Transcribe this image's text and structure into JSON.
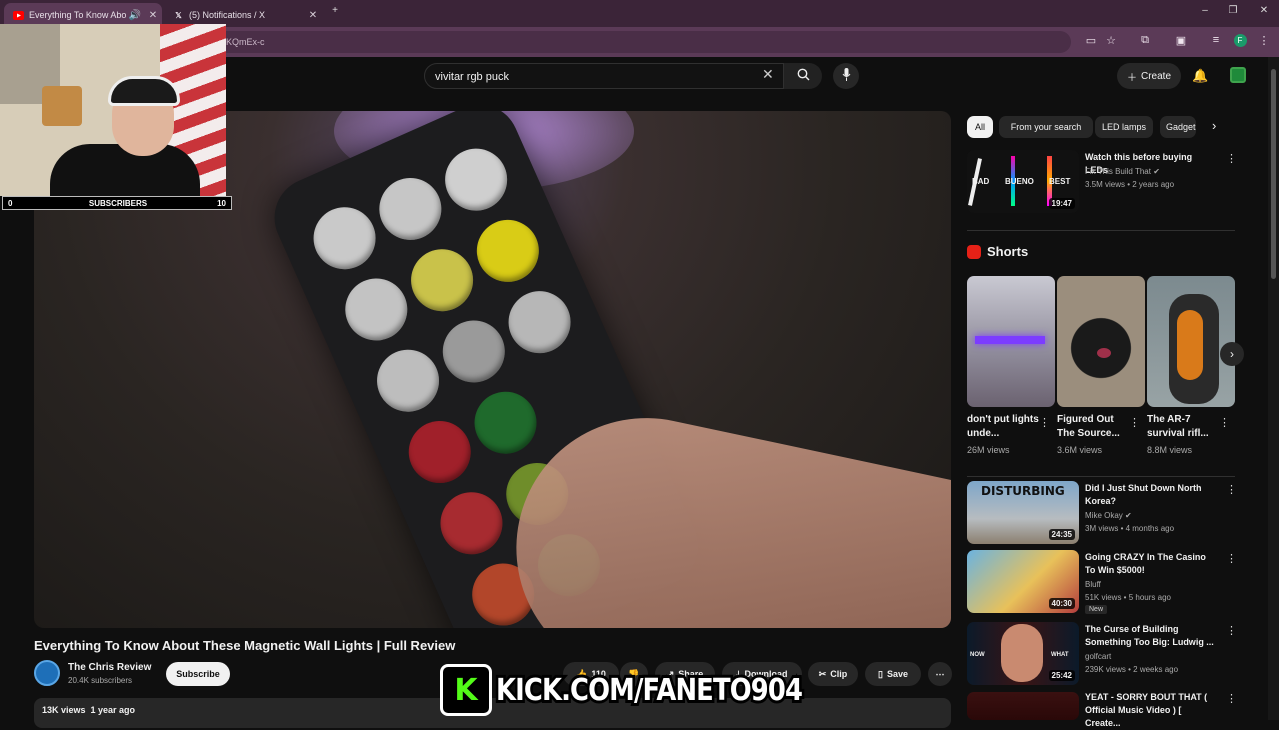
{
  "browser": {
    "tabs": [
      {
        "title": "Everything To Know About",
        "active": true,
        "audio_icon": "speaker-icon"
      },
      {
        "title": "(5) Notifications / X",
        "active": false
      }
    ],
    "new_tab": "+",
    "url_fragment": "KQmEx-c",
    "window_controls": [
      "–",
      "❐",
      "✕"
    ]
  },
  "youtube": {
    "search": {
      "value": "vivitar rgb puck"
    },
    "create_label": "Create",
    "video": {
      "title": "Everything To Know About These Magnetic Wall Lights | Full Review",
      "channel": "The Chris Review",
      "subscribers": "20.4K subscribers",
      "subscribe_label": "Subscribe",
      "actions": {
        "likes": "110",
        "share": "Share",
        "download": "Download",
        "clip": "Clip",
        "save": "Save"
      },
      "stats": "13K views  1 year ago"
    },
    "chips": [
      "All",
      "From your search",
      "LED lamps",
      "Gadgets"
    ],
    "recommendations": [
      {
        "title": "Watch this before buying LEDs",
        "channel": "Fix This Build That",
        "meta": "3.5M views • 2 years ago",
        "duration": "19:47",
        "thumb_labels": [
          "BAD",
          "BUENO",
          "BEST"
        ]
      },
      {
        "title": "Did I Just Shut Down North Korea?",
        "channel": "Mike Okay",
        "meta": "3M views • 4 months ago",
        "duration": "24:35",
        "thumb_label": "DISTURBING"
      },
      {
        "title": "Going CRAZY In The Casino To Win $5000!",
        "channel": "Bluff",
        "meta": "51K views • 5 hours ago",
        "badge": "New",
        "duration": "40:30"
      },
      {
        "title": "The Curse of Building Something Too Big: Ludwig ...",
        "channel": "golfcart",
        "meta": "239K views • 2 weeks ago",
        "duration": "25:42",
        "thumb_labels": [
          "NOW",
          "WHAT"
        ]
      },
      {
        "title": "YEAT - SORRY BOUT THAT ( Official Music Video ) [ Create..."
      }
    ],
    "shorts": {
      "heading": "Shorts",
      "items": [
        {
          "title": "don't put lights unde...",
          "views": "26M views"
        },
        {
          "title": "Figured Out The Source...",
          "views": "3.6M views"
        },
        {
          "title": "The AR-7 survival rifl...",
          "views": "8.8M views"
        }
      ]
    }
  },
  "overlay": {
    "subscriber_goal": {
      "left": "0",
      "label": "SUBSCRIBERS",
      "right": "10"
    },
    "kick_banner": "KICK.COM/FANETO904",
    "kick_logo": "K"
  },
  "colors": {
    "browser_frame": "#5b3a57",
    "youtube_bg": "#0f0f0f",
    "kick_green": "#53fc18",
    "shorts_red": "#e62117"
  }
}
